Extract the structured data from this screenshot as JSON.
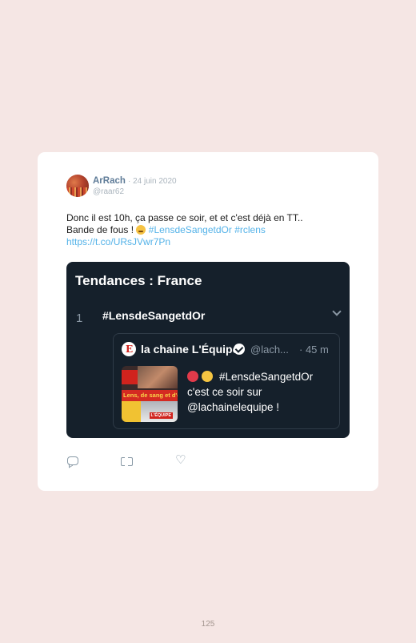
{
  "tweet": {
    "author_name": "ArRach",
    "date": "· 24 juin 2020",
    "handle": "@raar62",
    "text_line1": "Donc il est 10h, ça passe ce soir, et et c'est déjà en TT..",
    "text_line2_prefix": "Bande de fous !",
    "hashtag1": "#LensdeSangetdOr",
    "hashtag2": "#rclens",
    "url": "https://t.co/URsJVwr7Pn",
    "emoji_name": "sweat-smile-emoji"
  },
  "media": {
    "title": "Tendances : France",
    "rank": "1",
    "trend": "#LensdeSangetdOr",
    "quote": {
      "name": "la chaine L'Équipe",
      "handle": "@lach...",
      "time": "· 45 m",
      "text_line1": "#LensdeSangetdOr",
      "text_line2": "c'est ce soir sur",
      "text_line3": "@lachainelequipe !",
      "thumbnail_banner": "Lens, de sang et d'or",
      "thumbnail_badge": "L'ÉQUIPE",
      "dot_colors": [
        "#e23a4a",
        "#f5c542"
      ]
    }
  },
  "actions": {
    "reply_icon": "reply-icon",
    "retweet_icon": "retweet-icon",
    "like_icon": "like-icon"
  },
  "page_number": "125"
}
